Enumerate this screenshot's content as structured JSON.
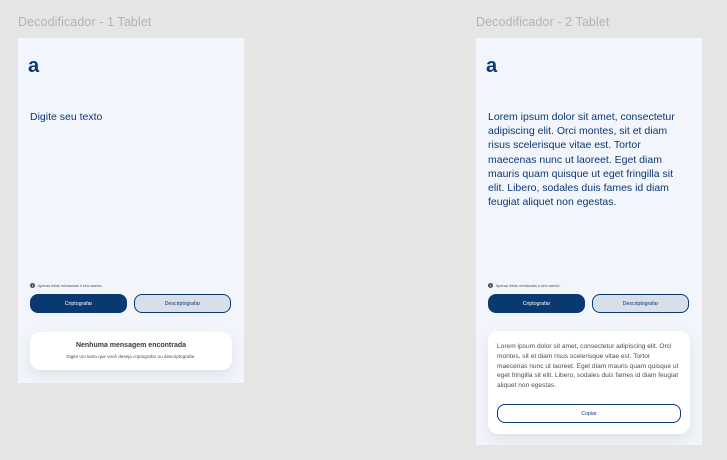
{
  "frames": [
    {
      "title": "Decodificador - 1 Tablet",
      "logo": "a",
      "input_text": "Digite seu texto",
      "hint": "Apenas letras minúsculas e sem acento.",
      "encrypt_label": "Criptografar",
      "decrypt_label": "Descriptografar",
      "empty_title": "Nenhuma mensagem encontrada",
      "empty_subtitle": "Digite um texto que você deseja criptografar ou descriptografar."
    },
    {
      "title": "Decodificador - 2 Tablet",
      "logo": "a",
      "input_text": "Lorem ipsum dolor sit amet, consectetur adipiscing elit. Orci montes, sit et diam risus scelerisque vitae est. Tortor maecenas nunc ut laoreet. Eget diam mauris quam quisque ut eget fringilla sit elit. Libero, sodales duis fames id diam feugiat aliquet non egestas.",
      "hint": "Apenas letras minúsculas e sem acento.",
      "encrypt_label": "Criptografar",
      "decrypt_label": "Descriptografar",
      "result_text": "Lorem ipsum dolor sit amet, consectetur adipiscing elit. Orci montes, sit et diam risus scelerisque vitae est. Tortor maecenas nunc ut laoreet. Eget diam mauris quam quisque ut eget fringilla sit elit. Libero, sodales duis fames id diam feugiat aliquet non egestas.",
      "copy_label": "Copiar"
    }
  ],
  "colors": {
    "primary": "#0a3871",
    "background": "#f3f5fc",
    "canvas": "#e5e5e5"
  },
  "icons": {
    "info": "info-circle-icon"
  }
}
